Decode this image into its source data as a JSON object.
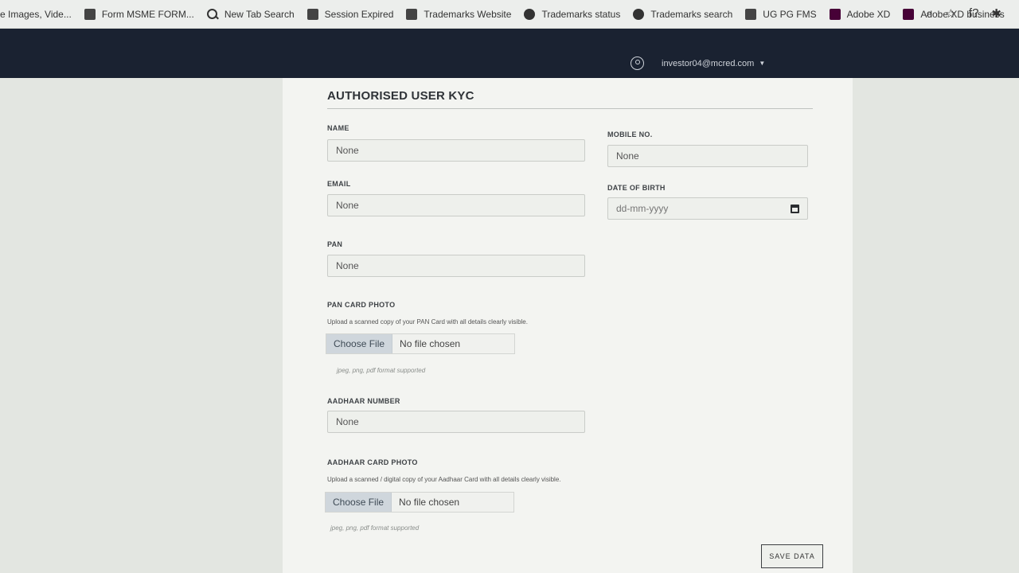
{
  "bookmarks": [
    {
      "label": "e Images, Vide...",
      "icon": "none"
    },
    {
      "label": "Form MSME FORM...",
      "icon": "document-icon"
    },
    {
      "label": "New Tab Search",
      "icon": "search-icon"
    },
    {
      "label": "Session Expired",
      "icon": "page-icon"
    },
    {
      "label": "Trademarks Website",
      "icon": "chess-icon"
    },
    {
      "label": "Trademarks status",
      "icon": "globe-icon"
    },
    {
      "label": "Trademarks search",
      "icon": "globe-icon"
    },
    {
      "label": "UG PG FMS",
      "icon": "bookmark-icon"
    },
    {
      "label": "Adobe XD",
      "icon": "adobe-xd-icon"
    },
    {
      "label": "Adobe XD business",
      "icon": "adobe-xd-icon"
    }
  ],
  "browser_tools": {
    "zoom": "⌕",
    "star": "☆",
    "fx": "f?",
    "puzzle": "✱"
  },
  "nav": {
    "user_email": "investor04@mcred.com",
    "caret": "▼"
  },
  "form": {
    "title": "AUTHORISED USER KYC",
    "name": {
      "label": "NAME",
      "value": "None"
    },
    "mobile": {
      "label": "MOBILE NO.",
      "value": "None"
    },
    "email": {
      "label": "EMAIL",
      "value": "None"
    },
    "dob": {
      "label": "DATE OF BIRTH",
      "placeholder": "dd-mm-yyyy"
    },
    "pan": {
      "label": "PAN",
      "value": "None"
    },
    "pan_photo": {
      "label": "PAN CARD PHOTO",
      "help": "Upload a scanned copy of your PAN Card with all details clearly visible.",
      "choose": "Choose File",
      "status": "No file chosen",
      "hint": "jpeg, png, pdf format supported"
    },
    "aadhaar": {
      "label": "AADHAAR NUMBER",
      "value": "None"
    },
    "aadhaar_photo": {
      "label": "AADHAAR CARD PHOTO",
      "help": "Upload a scanned / digital copy of your Aadhaar Card with all details clearly visible.",
      "choose": "Choose File",
      "status": "No file chosen",
      "hint": "jpeg, png, pdf format supported"
    },
    "save_label": "SAVE DATA"
  },
  "colors": {
    "nav_bg": "#1a2231",
    "card_bg": "#f3f4f1",
    "page_bg": "#e3e6e1"
  }
}
